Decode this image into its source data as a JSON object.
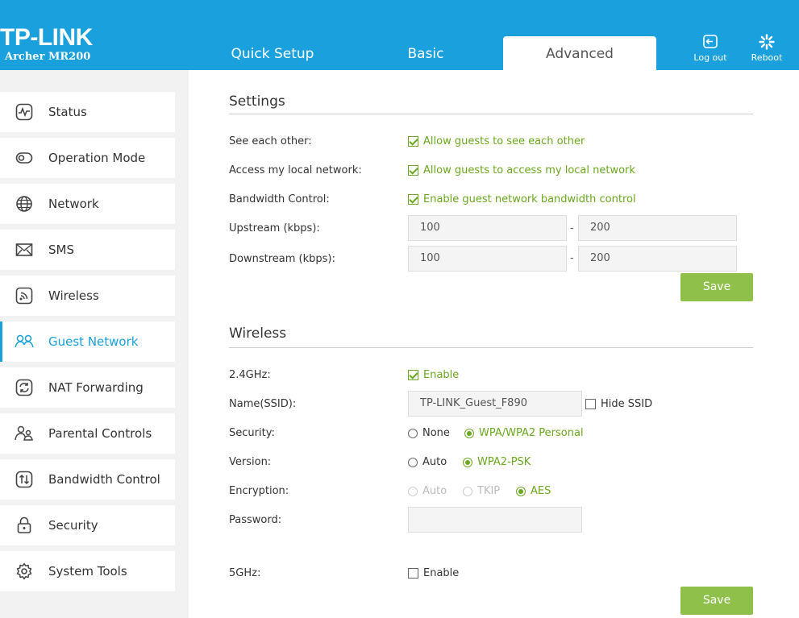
{
  "header": {
    "logo": "TP-LINK",
    "model": "Archer MR200",
    "tabs": [
      "Quick Setup",
      "Basic",
      "Advanced"
    ],
    "logout_label": "Log out",
    "reboot_label": "Reboot"
  },
  "sidebar": {
    "items": [
      {
        "label": "Status",
        "icon": "status-icon"
      },
      {
        "label": "Operation Mode",
        "icon": "operation-mode-icon"
      },
      {
        "label": "Network",
        "icon": "globe-icon"
      },
      {
        "label": "SMS",
        "icon": "envelope-icon"
      },
      {
        "label": "Wireless",
        "icon": "wireless-icon"
      },
      {
        "label": "Guest Network",
        "icon": "guest-network-icon"
      },
      {
        "label": "NAT Forwarding",
        "icon": "nat-forwarding-icon"
      },
      {
        "label": "Parental Controls",
        "icon": "parental-controls-icon"
      },
      {
        "label": "Bandwidth Control",
        "icon": "bandwidth-icon"
      },
      {
        "label": "Security",
        "icon": "lock-icon"
      },
      {
        "label": "System Tools",
        "icon": "gear-icon"
      }
    ],
    "active": "Guest Network"
  },
  "settings": {
    "title": "Settings",
    "see_each_other_label": "See each other:",
    "see_each_other_option": "Allow guests to see each other",
    "local_network_label": "Access my local network:",
    "local_network_option": "Allow guests to access my local network",
    "bandwidth_label": "Bandwidth Control:",
    "bandwidth_option": "Enable guest network bandwidth control",
    "upstream_label": "Upstream (kbps):",
    "upstream_min": "100",
    "upstream_max": "200",
    "downstream_label": "Downstream (kbps):",
    "downstream_min": "100",
    "downstream_max": "200",
    "range_separator": "-",
    "save_label": "Save"
  },
  "wireless": {
    "title": "Wireless",
    "band24_label": "2.4GHz:",
    "band24_enable": "Enable",
    "ssid_label": "Name(SSID):",
    "ssid_value": "TP-LINK_Guest_F890",
    "hide_ssid": "Hide SSID",
    "security_label": "Security:",
    "security_none": "None",
    "security_wpa": "WPA/WPA2 Personal",
    "version_label": "Version:",
    "version_auto": "Auto",
    "version_wpa2": "WPA2-PSK",
    "encryption_label": "Encryption:",
    "enc_auto": "Auto",
    "enc_tkip": "TKIP",
    "enc_aes": "AES",
    "password_label": "Password:",
    "password_value": "",
    "band5_label": "5GHz:",
    "band5_enable": "Enable",
    "save_label": "Save"
  },
  "colors": {
    "brand": "#1aa1dd",
    "accent_green": "#6aa81e",
    "button_green": "#8fc04a"
  }
}
